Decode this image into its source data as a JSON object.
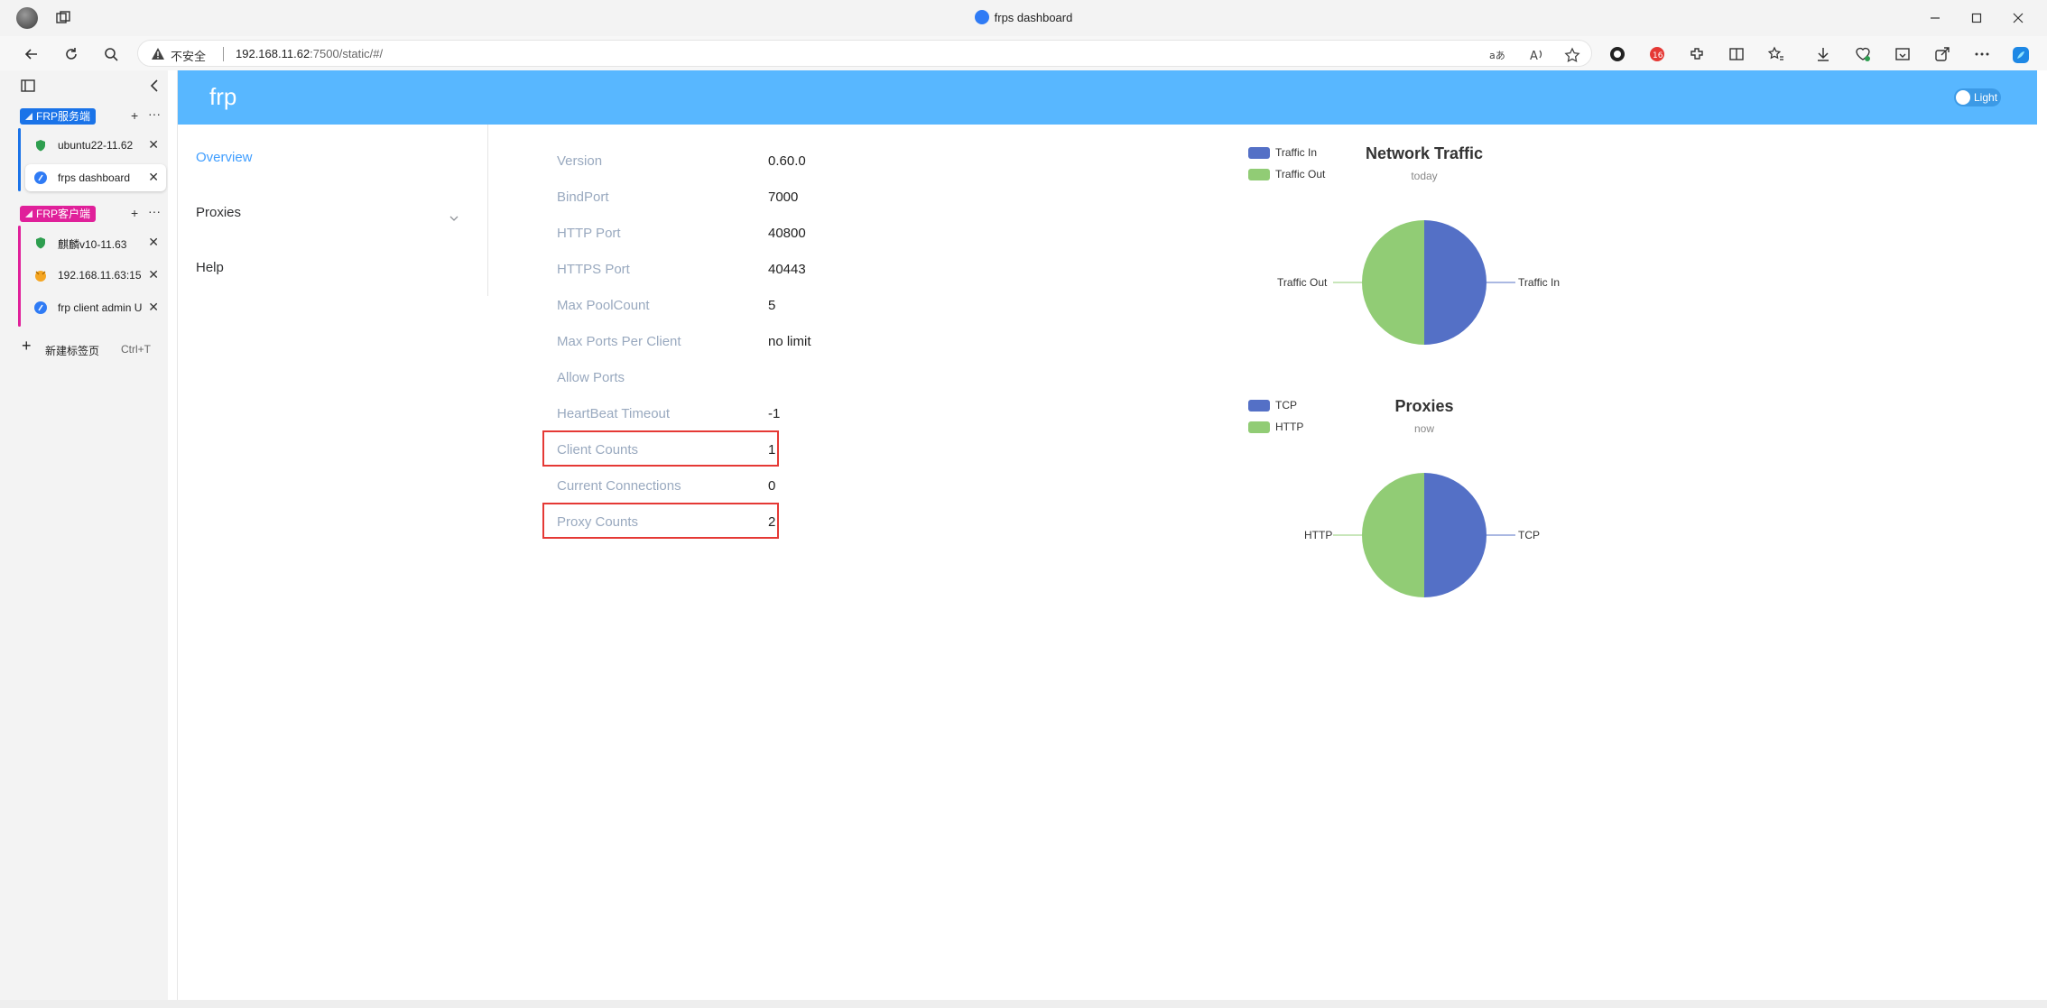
{
  "window": {
    "title": "frps dashboard"
  },
  "addressbar": {
    "security_label": "不安全",
    "url_host": "192.168.11.62",
    "url_path": ":7500/static/#/"
  },
  "tabs": {
    "groups": [
      {
        "name": "FRP服务端",
        "color": "#1a73e8",
        "items": [
          {
            "label": "ubuntu22-11.62",
            "active": false
          },
          {
            "label": "frps dashboard",
            "active": true
          }
        ]
      },
      {
        "name": "FRP客户端",
        "color": "#e0209a",
        "items": [
          {
            "label": "麒麟v10-11.63",
            "active": false
          },
          {
            "label": "192.168.11.63:15",
            "active": false
          },
          {
            "label": "frp client admin U",
            "active": false
          }
        ]
      }
    ],
    "new_tab": {
      "label": "新建标签页",
      "shortcut": "Ctrl+T"
    }
  },
  "app": {
    "brand": "frp",
    "theme_toggle": "Light",
    "menu": [
      {
        "label": "Overview",
        "active": true
      },
      {
        "label": "Proxies",
        "active": false
      },
      {
        "label": "Help",
        "active": false
      }
    ]
  },
  "server_info": [
    {
      "key": "Version",
      "value": "0.60.0"
    },
    {
      "key": "BindPort",
      "value": "7000"
    },
    {
      "key": "HTTP Port",
      "value": "40800"
    },
    {
      "key": "HTTPS Port",
      "value": "40443"
    },
    {
      "key": "Max PoolCount",
      "value": "5"
    },
    {
      "key": "Max Ports Per Client",
      "value": "no limit"
    },
    {
      "key": "Allow Ports",
      "value": ""
    },
    {
      "key": "HeartBeat Timeout",
      "value": "-1"
    },
    {
      "key": "Client Counts",
      "value": "1"
    },
    {
      "key": "Current Connections",
      "value": "0"
    },
    {
      "key": "Proxy Counts",
      "value": "2"
    }
  ],
  "chart_data": [
    {
      "type": "pie",
      "title": "Network Traffic",
      "subtitle": "today",
      "legend": [
        "Traffic In",
        "Traffic Out"
      ],
      "slices": [
        {
          "name": "Traffic In",
          "value": 50,
          "color": "#5470c6"
        },
        {
          "name": "Traffic Out",
          "value": 50,
          "color": "#91cc75"
        }
      ]
    },
    {
      "type": "pie",
      "title": "Proxies",
      "subtitle": "now",
      "legend": [
        "TCP",
        "HTTP"
      ],
      "slices": [
        {
          "name": "TCP",
          "value": 1,
          "color": "#5470c6"
        },
        {
          "name": "HTTP",
          "value": 1,
          "color": "#91cc75"
        }
      ]
    }
  ]
}
